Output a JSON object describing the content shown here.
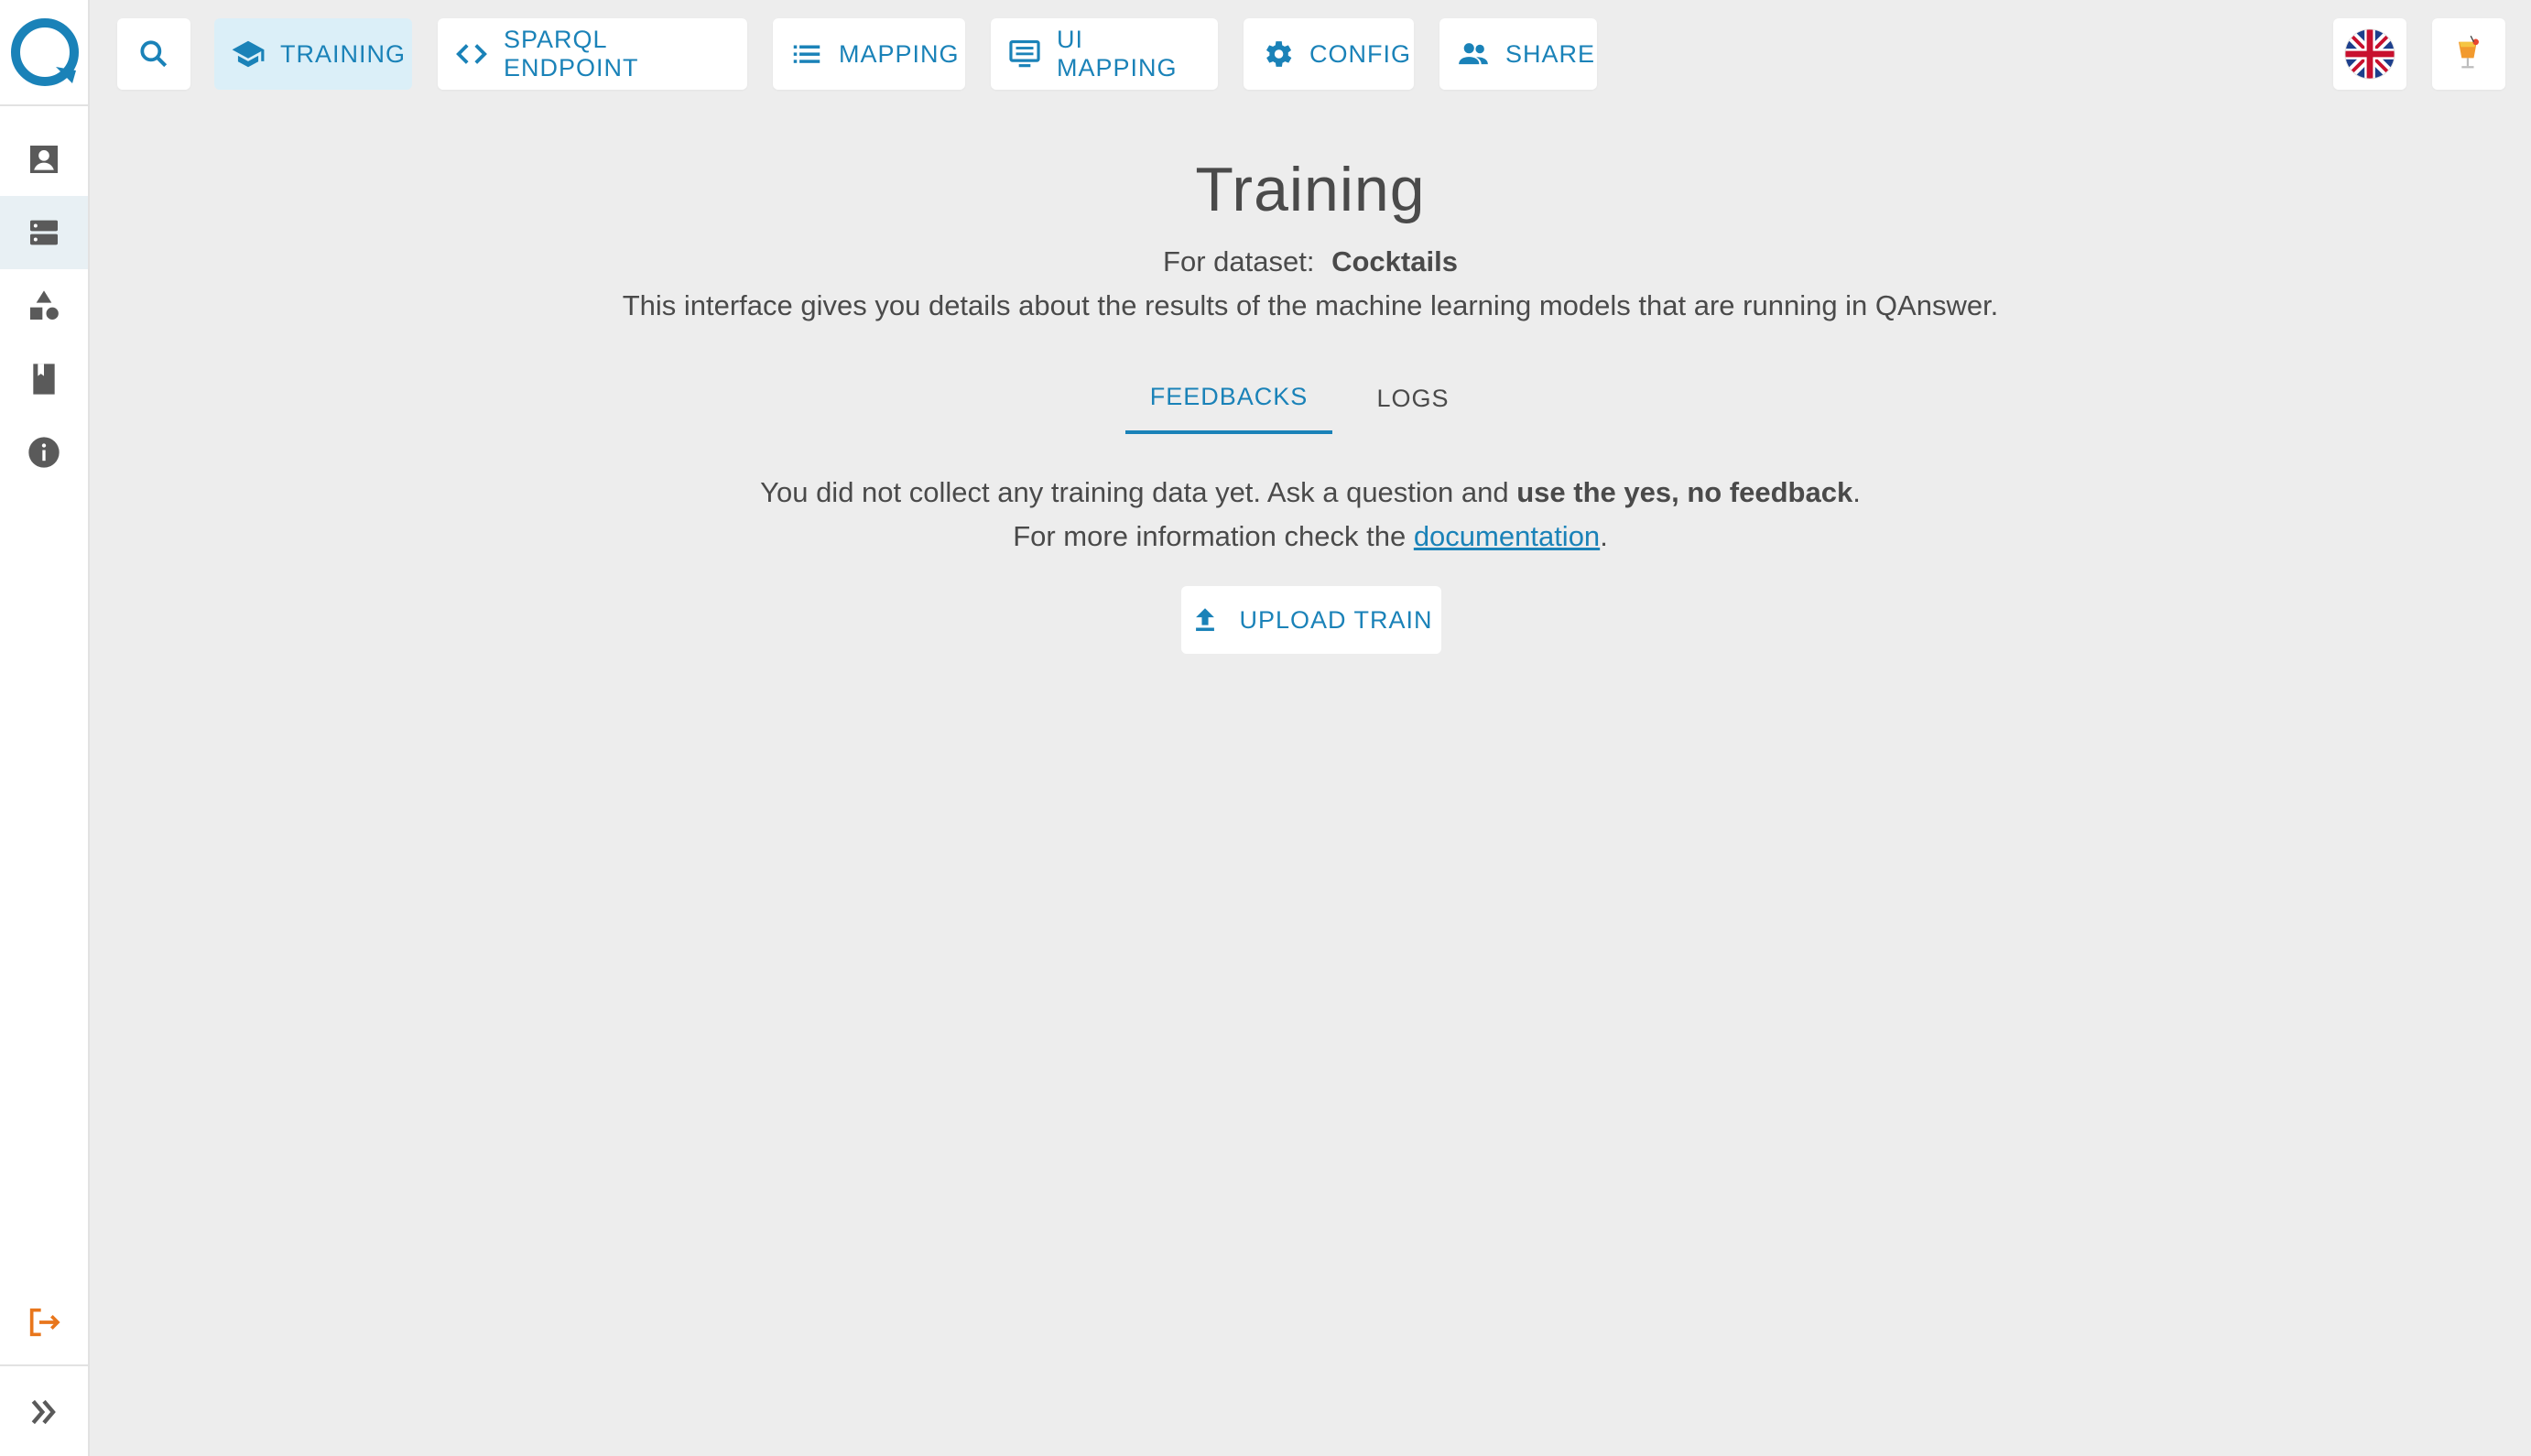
{
  "app": {
    "logo_icon": "qanswer-logo-icon",
    "accent_color": "#1a82b8",
    "logout_color": "#e8761c"
  },
  "sidebar": {
    "items": [
      {
        "icon": "user-account-icon"
      },
      {
        "icon": "datasets-icon",
        "active": true
      },
      {
        "icon": "shapes-icon"
      },
      {
        "icon": "book-icon"
      },
      {
        "icon": "info-icon"
      }
    ],
    "logout_icon": "logout-icon",
    "expand_icon": "expand-chevrons-icon"
  },
  "topbar": {
    "search_icon": "search-icon",
    "tabs": [
      {
        "label": "TRAINING",
        "icon": "graduation-cap-icon",
        "active": true
      },
      {
        "label": "SPARQL ENDPOINT",
        "icon": "code-icon"
      },
      {
        "label": "MAPPING",
        "icon": "list-icon"
      },
      {
        "label": "UI MAPPING",
        "icon": "monitor-icon"
      },
      {
        "label": "CONFIG",
        "icon": "gear-icon"
      },
      {
        "label": "SHARE",
        "icon": "people-icon"
      }
    ],
    "language_icon": "uk-flag-icon",
    "dataset_icon": "cocktail-icon"
  },
  "main": {
    "title": "Training",
    "dataset_prefix": "For dataset:",
    "dataset_name": "Cocktails",
    "description": "This interface gives you details about the results of the machine learning models that are running in QAnswer.",
    "tabs": [
      {
        "label": "FEEDBACKS",
        "active": true
      },
      {
        "label": "LOGS",
        "active": false
      }
    ],
    "empty_msg_start": "You did not collect any training data yet. Ask a question and ",
    "empty_msg_bold": "use the yes, no feedback",
    "empty_msg_end": ".",
    "info_msg_start": "For more information check the ",
    "info_link": "documentation",
    "info_msg_end": ".",
    "upload_button": "UPLOAD TRAIN",
    "upload_icon": "upload-icon"
  }
}
